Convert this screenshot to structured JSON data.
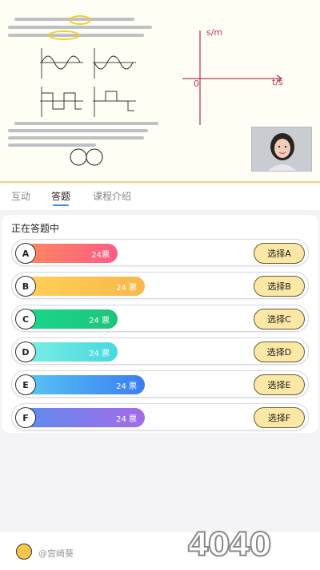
{
  "tabs": [
    {
      "label": "互动"
    },
    {
      "label": "答题"
    },
    {
      "label": "课程介绍"
    }
  ],
  "active_tab": "答题",
  "quiz": {
    "title": "正在答题中",
    "options": [
      {
        "letter": "A",
        "votes_label": "24票",
        "button_label": "选择A",
        "color": "#ff6b7a"
      },
      {
        "letter": "B",
        "votes_label": "24 票",
        "button_label": "选择B",
        "color": "#fbc24a"
      },
      {
        "letter": "C",
        "votes_label": "24 票",
        "button_label": "选择C",
        "color": "#1fd38a"
      },
      {
        "letter": "D",
        "votes_label": "24 票",
        "button_label": "选择D",
        "color": "#57e3e0"
      },
      {
        "letter": "E",
        "votes_label": "24 票",
        "button_label": "选择E",
        "color": "#3f8ef5"
      },
      {
        "letter": "F",
        "votes_label": "24 票",
        "button_label": "选择F",
        "color": "#a070e8"
      }
    ]
  },
  "lecture": {
    "board_y_label": "s/m",
    "board_x_label": "t/s",
    "board_origin": "0"
  },
  "footer": {
    "username": "@宫崎葵",
    "watermark": "4040"
  }
}
